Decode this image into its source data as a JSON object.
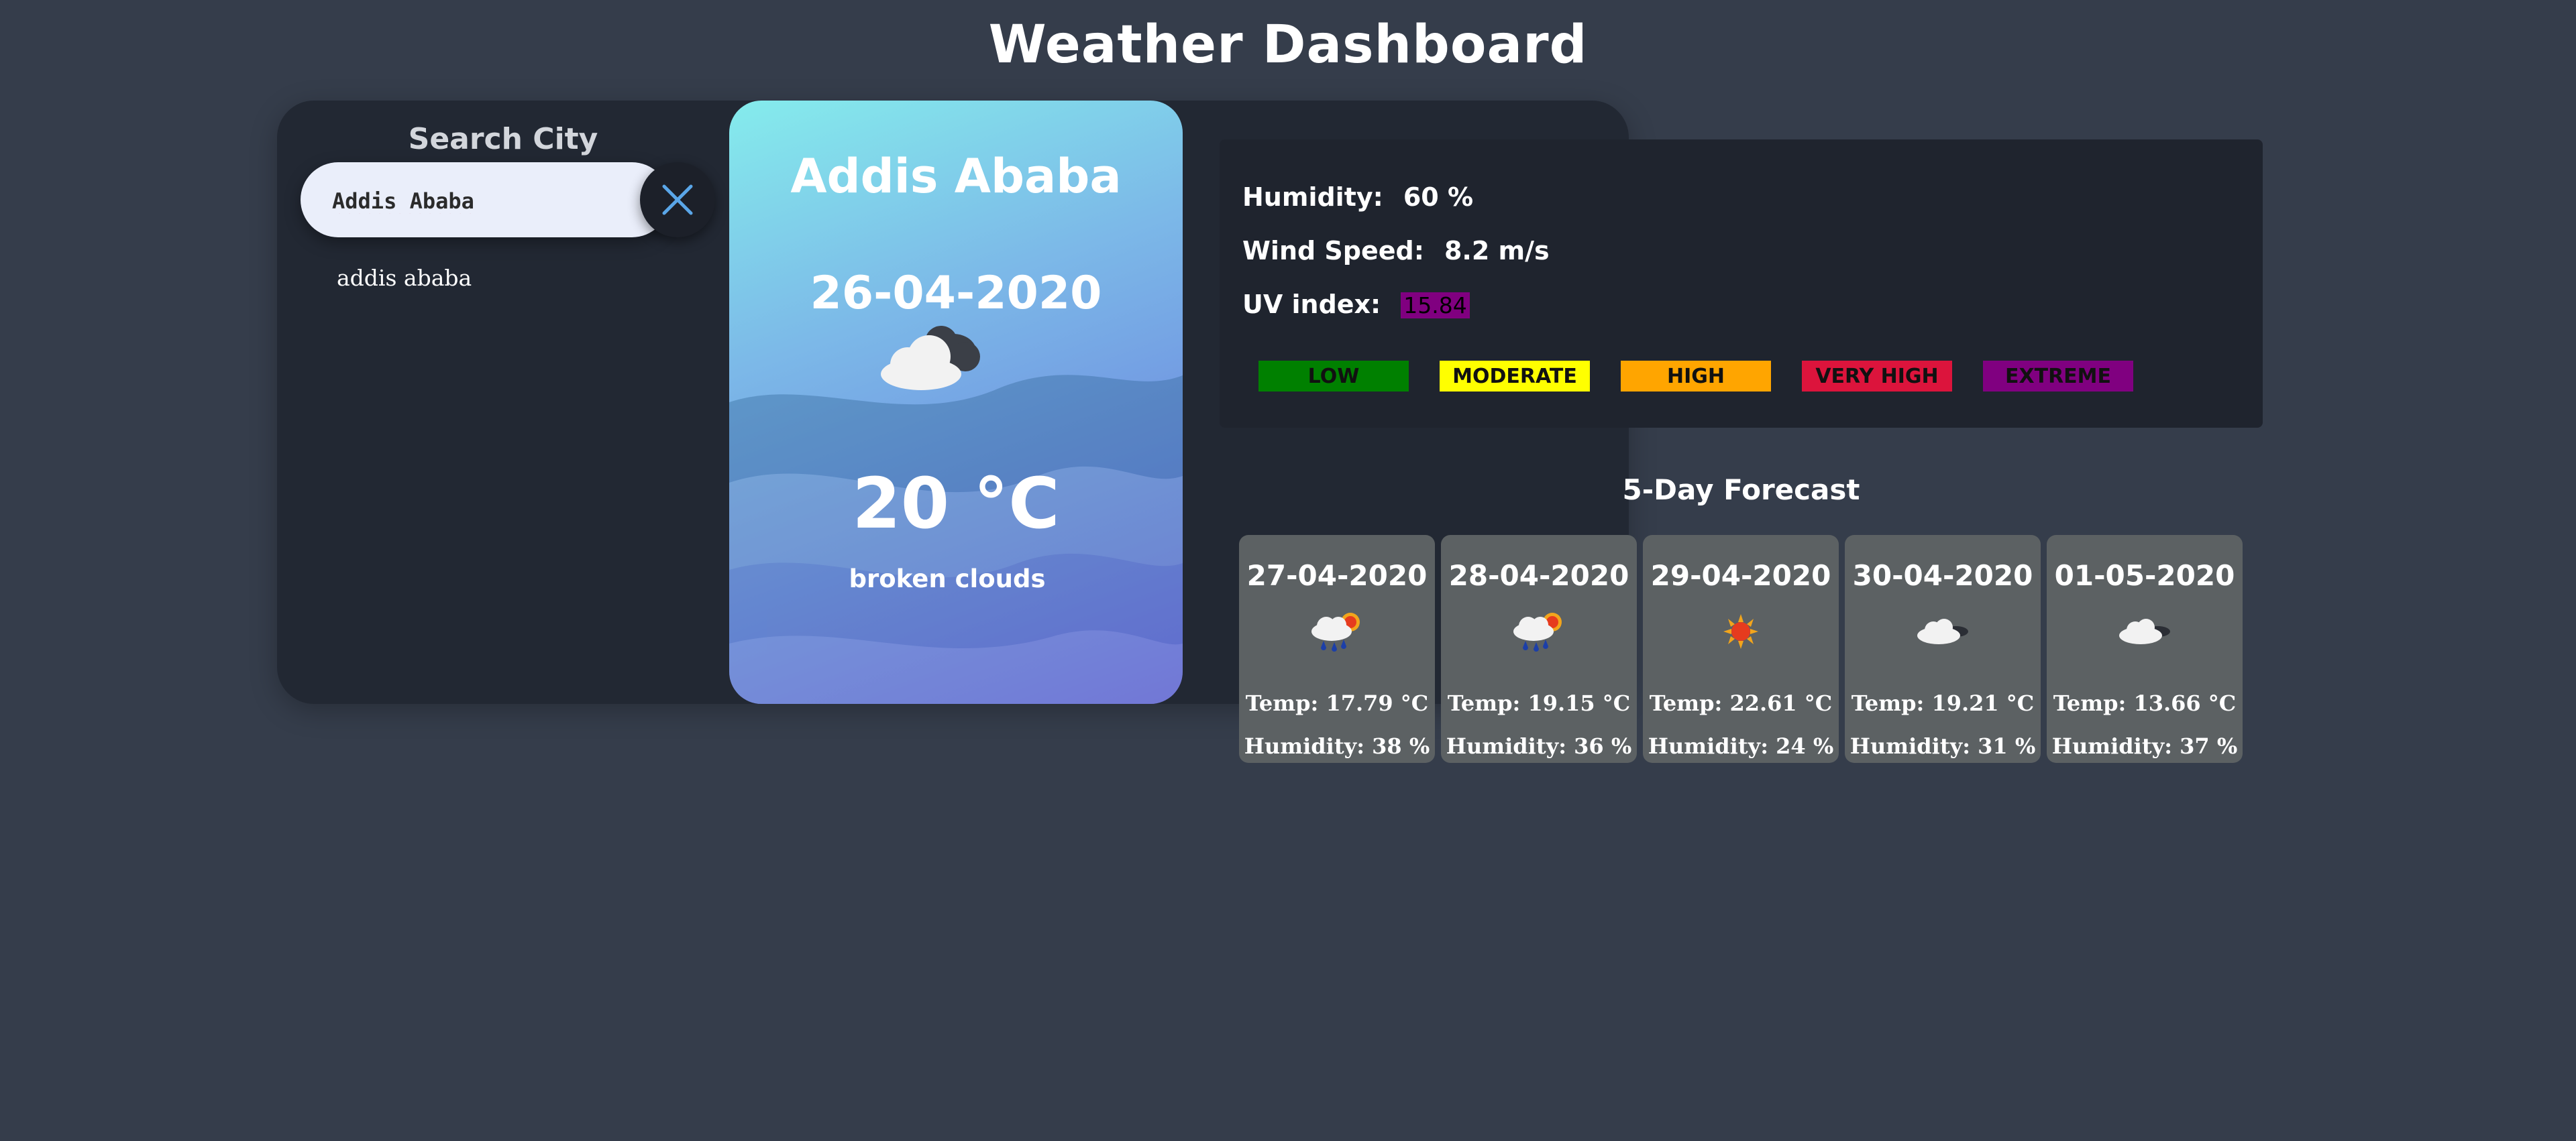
{
  "header": {
    "title": "Weather Dashboard"
  },
  "search": {
    "heading": "Search City",
    "value": "Addis Ababa",
    "clear_icon": "close-icon",
    "suggestions": [
      "addis ababa"
    ]
  },
  "current": {
    "city": "Addis Ababa",
    "date": "26-04-2020",
    "icon": "broken-clouds-icon",
    "temperature": "20 °C",
    "description": "broken clouds"
  },
  "details": {
    "humidity_label": "Humidity:",
    "humidity_value": "60 %",
    "wind_label": "Wind Speed:",
    "wind_value": "8.2 m/s",
    "uv_label": "UV index:",
    "uv_value": "15.84",
    "uv_value_color": "#800080"
  },
  "uv_scale": [
    {
      "label": "LOW",
      "color": "#008000"
    },
    {
      "label": "MODERATE",
      "color": "#ffff00"
    },
    {
      "label": "HIGH",
      "color": "#ffa500"
    },
    {
      "label": "VERY HIGH",
      "color": "#dc143c"
    },
    {
      "label": "EXTREME",
      "color": "#800080"
    }
  ],
  "forecast": {
    "title": "5-Day Forecast",
    "days": [
      {
        "date": "27-04-2020",
        "icon": "rain-sun-icon",
        "temp": "Temp: 17.79 °C",
        "humidity": "Humidity: 38 %"
      },
      {
        "date": "28-04-2020",
        "icon": "rain-sun-icon",
        "temp": "Temp: 19.15 °C",
        "humidity": "Humidity: 36 %"
      },
      {
        "date": "29-04-2020",
        "icon": "sun-icon",
        "temp": "Temp: 22.61 °C",
        "humidity": "Humidity: 24 %"
      },
      {
        "date": "30-04-2020",
        "icon": "cloud-night-icon",
        "temp": "Temp: 19.21 °C",
        "humidity": "Humidity: 31 %"
      },
      {
        "date": "01-05-2020",
        "icon": "cloud-night-icon",
        "temp": "Temp: 13.66 °C",
        "humidity": "Humidity: 37 %"
      }
    ]
  }
}
